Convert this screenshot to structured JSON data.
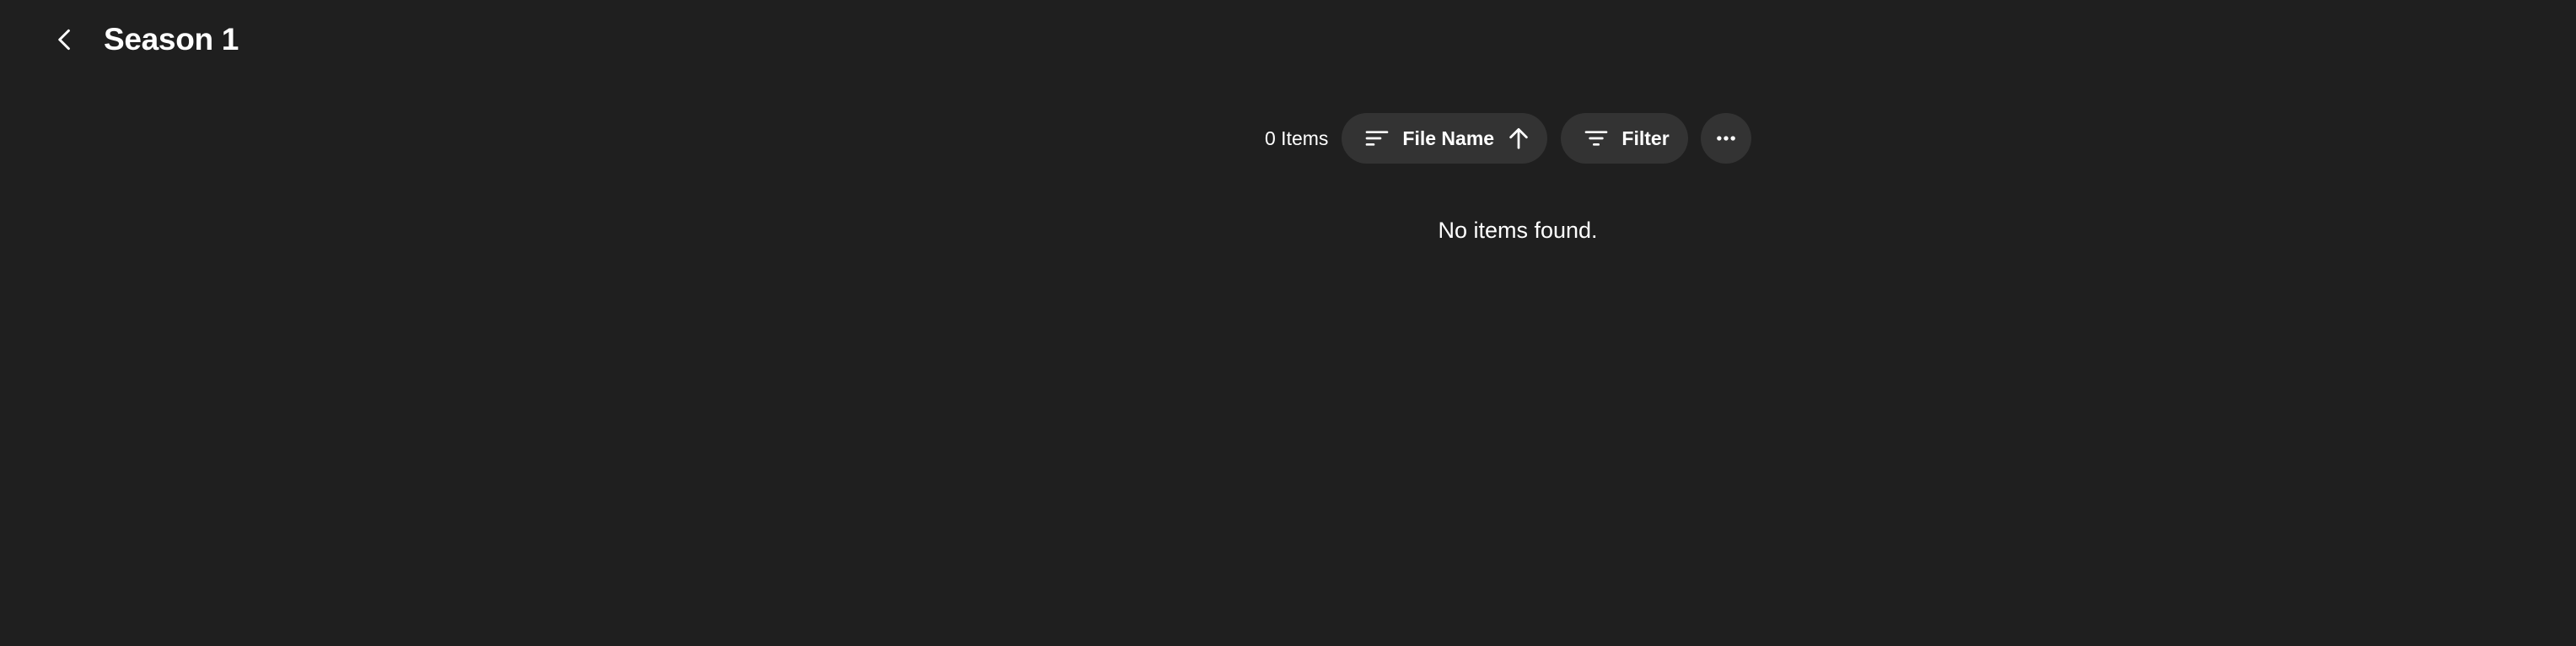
{
  "header": {
    "title": "Season 1",
    "back_icon": "chevron-left-icon"
  },
  "toolbar": {
    "item_count": "0 Items",
    "sort": {
      "label": "File Name",
      "icon": "sort-lines-icon",
      "direction_icon": "arrow-up-icon"
    },
    "filter": {
      "label": "Filter",
      "icon": "filter-icon"
    },
    "more": {
      "icon": "more-horizontal-icon"
    }
  },
  "main": {
    "empty_message": "No items found."
  },
  "colors": {
    "background": "#1f1f1f",
    "pill": "#333333",
    "text": "#ffffff"
  }
}
